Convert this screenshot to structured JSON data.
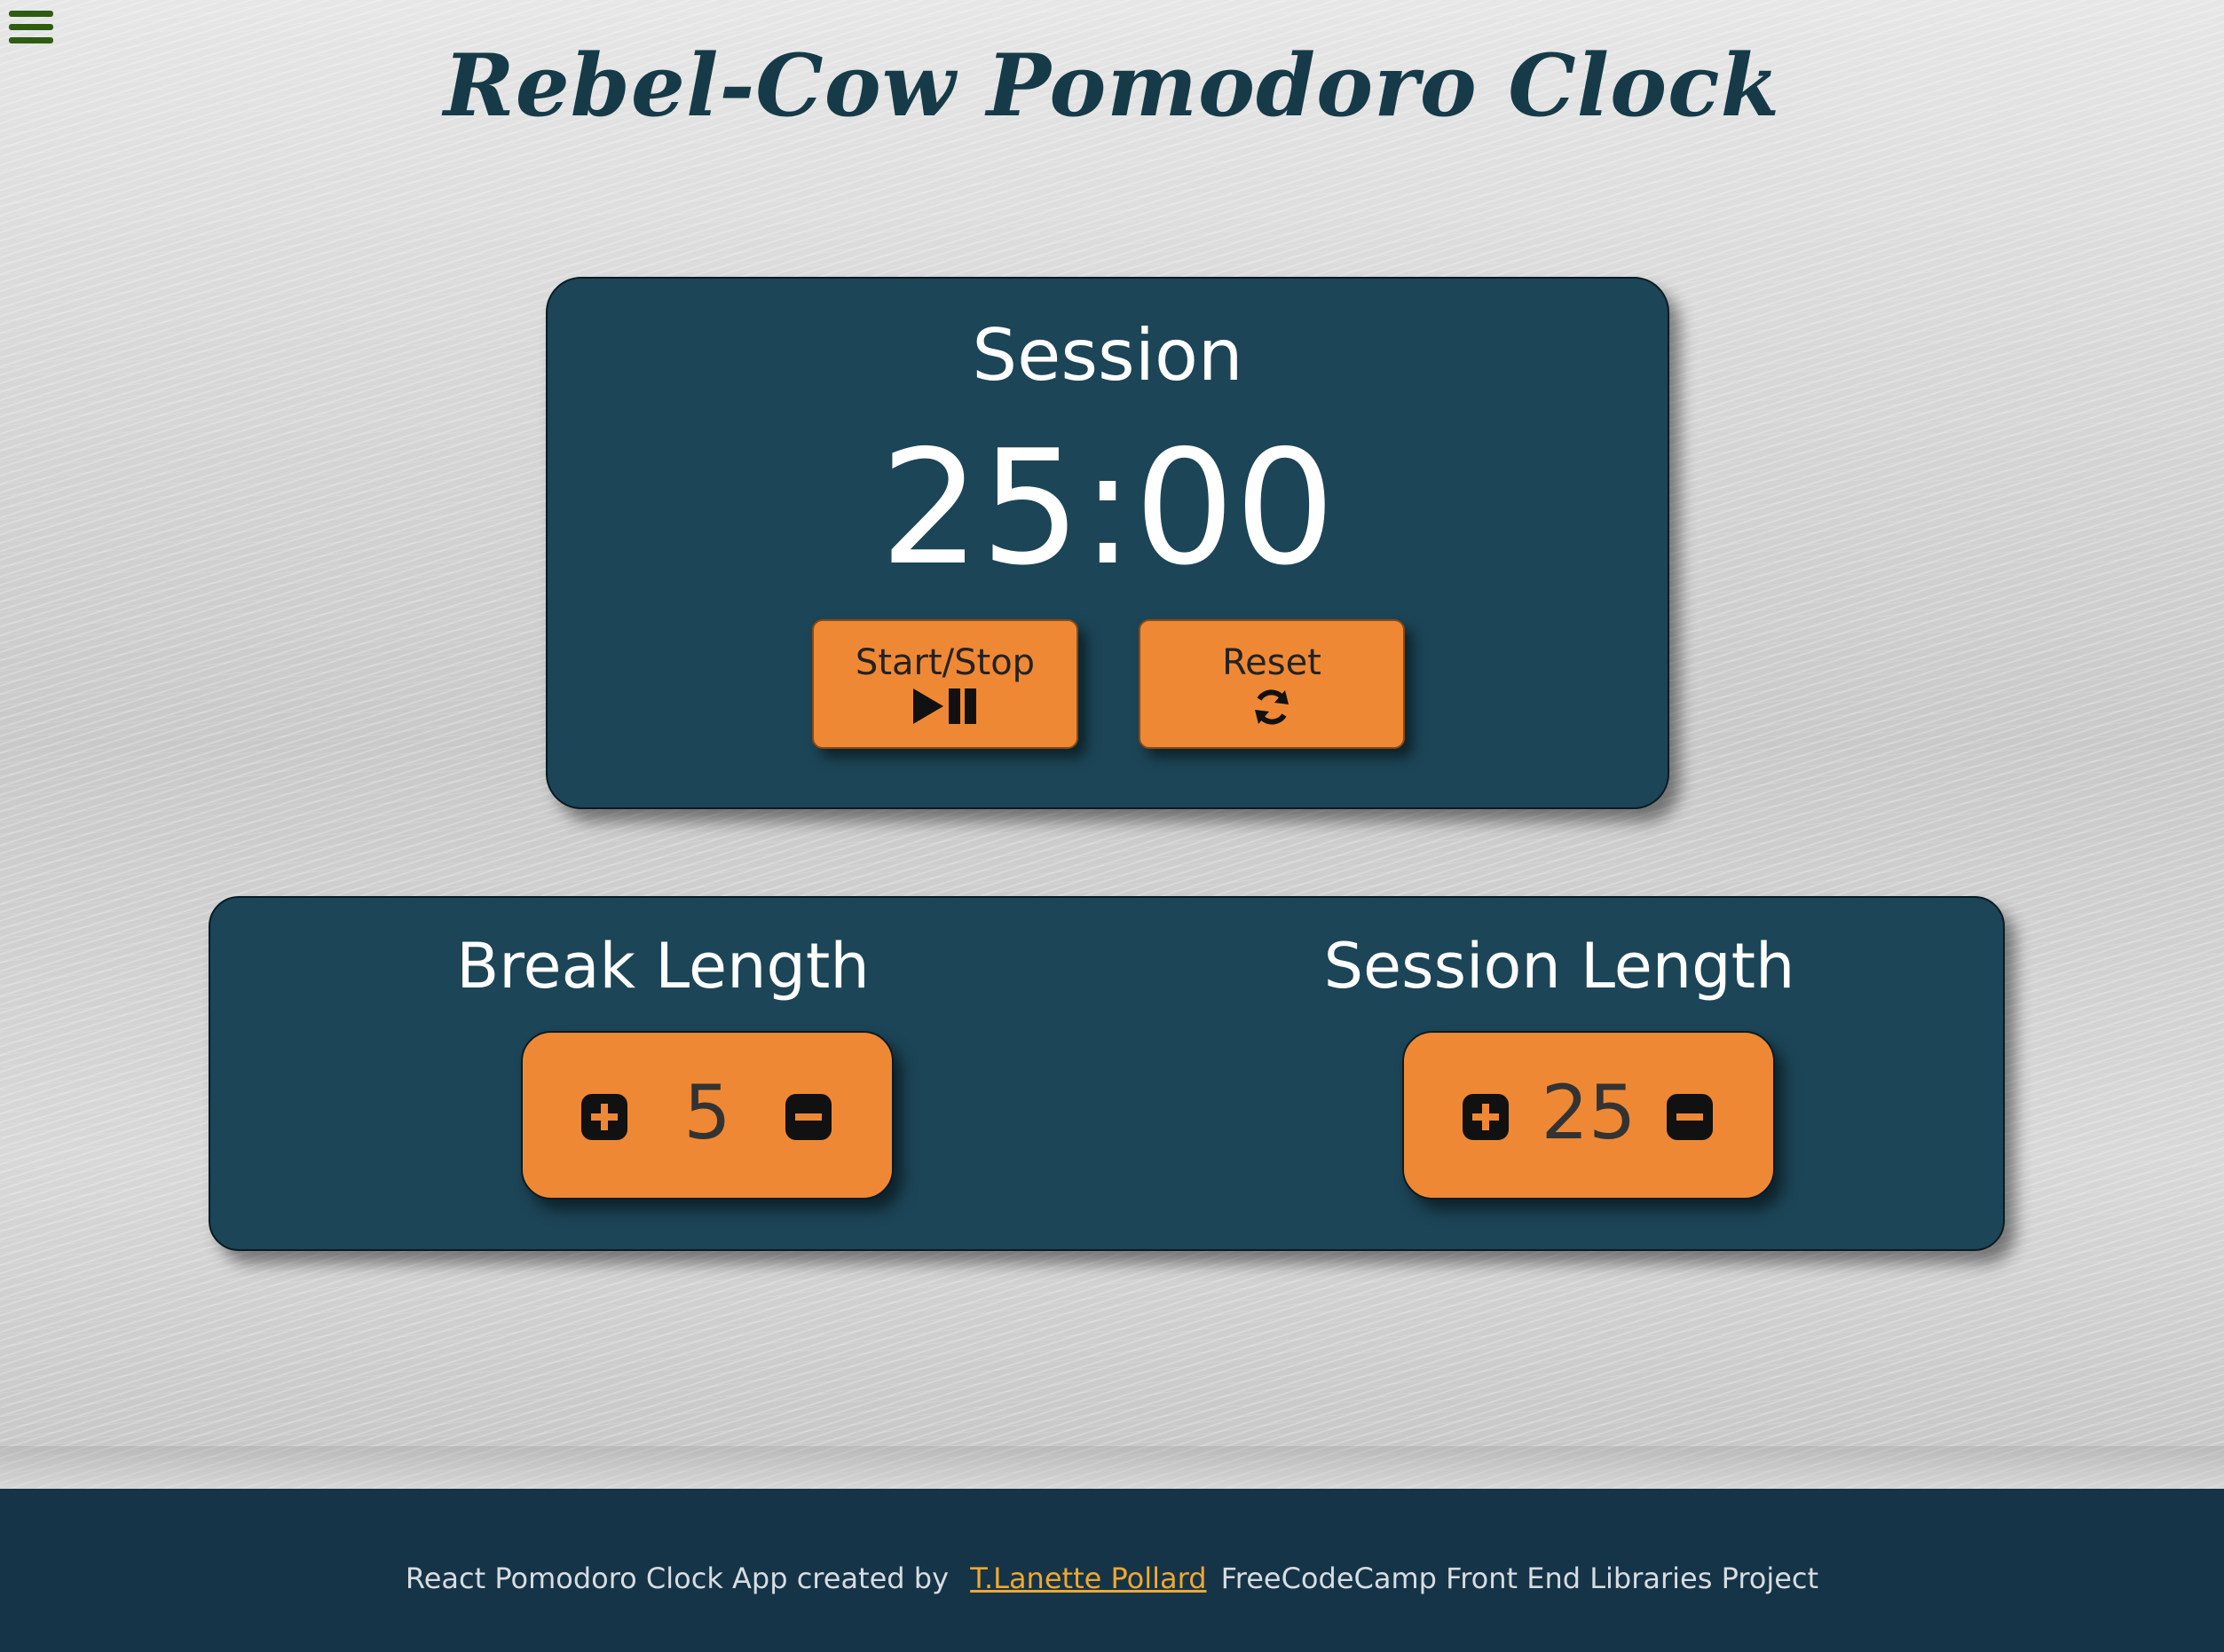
{
  "header": {
    "title": "Rebel-Cow Pomodoro Clock",
    "menu_icon": "hamburger-menu-icon"
  },
  "timer": {
    "label": "Session",
    "time_left": "25:00",
    "start_stop_label": "Start/Stop",
    "start_stop_icon": "play-pause-icon",
    "reset_label": "Reset",
    "reset_icon": "refresh-icon"
  },
  "break": {
    "label": "Break Length",
    "value": "5",
    "increment_icon": "plus-square-icon",
    "decrement_icon": "minus-square-icon"
  },
  "session": {
    "label": "Session Length",
    "value": "25",
    "increment_icon": "plus-square-icon",
    "decrement_icon": "minus-square-icon"
  },
  "footer": {
    "prefix": "React Pomodoro Clock App created by",
    "author_link": "T.Lanette Pollard",
    "suffix": "FreeCodeCamp Front End Libraries Project"
  },
  "colors": {
    "panel": "#1c4557",
    "accent": "#ef8834",
    "title": "#163a48",
    "footer_bg": "#163447",
    "link": "#f0a830",
    "menu": "#2e5d12"
  }
}
